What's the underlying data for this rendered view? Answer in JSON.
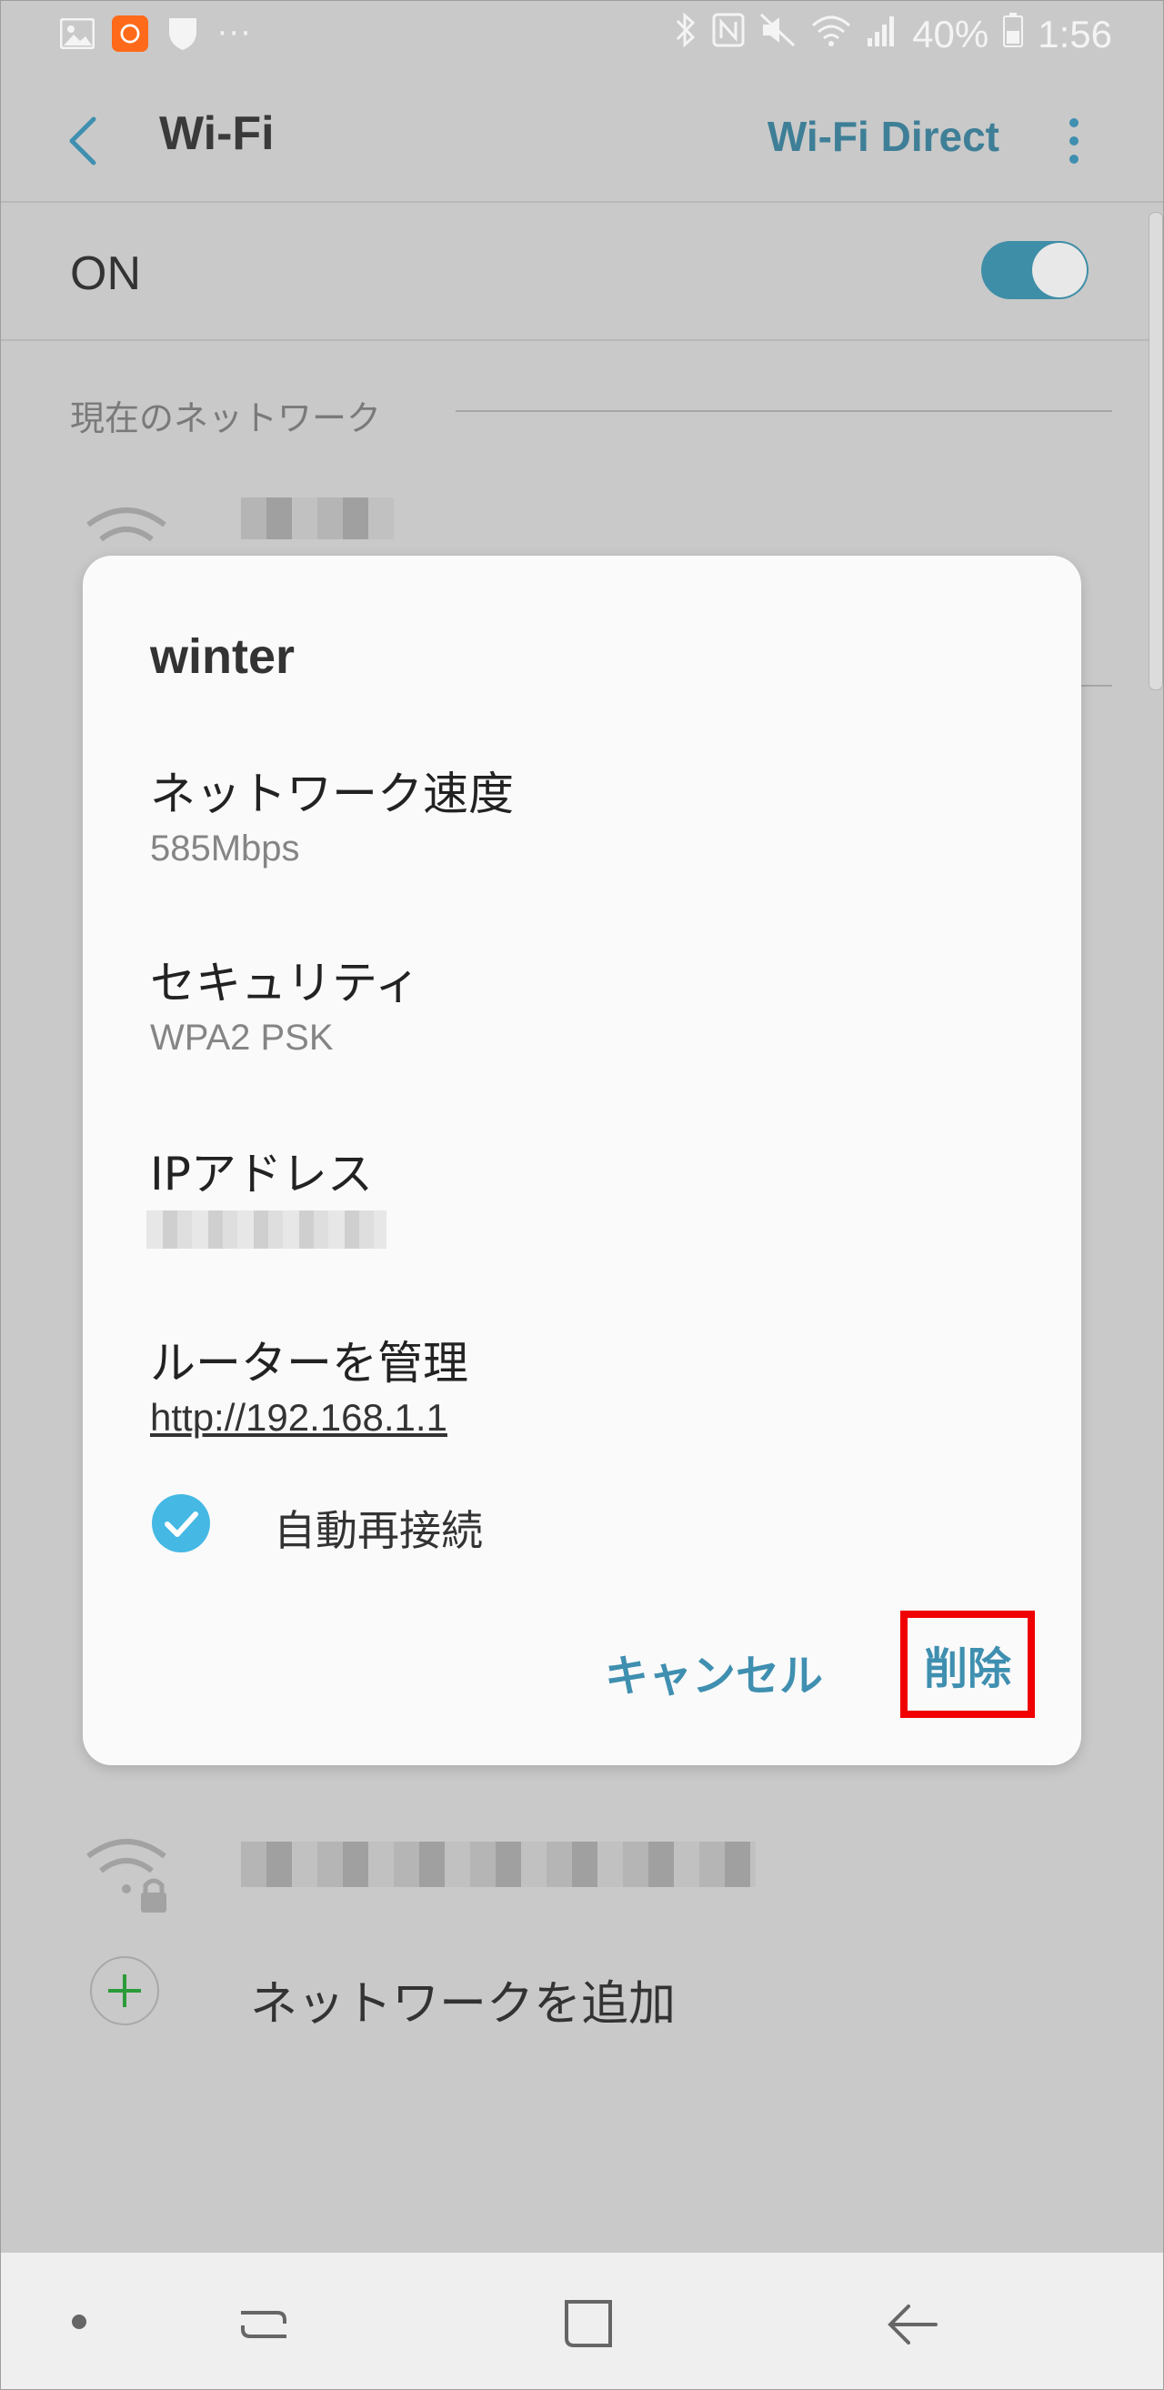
{
  "status_bar": {
    "battery": "40%",
    "time": "1:56",
    "overflow": "···",
    "icons": [
      "gallery-icon",
      "app-icon",
      "shield-icon",
      "bluetooth-icon",
      "nfc-icon",
      "mute-icon",
      "wifi-icon",
      "signal-icon",
      "battery-icon"
    ]
  },
  "app_bar": {
    "title": "Wi-Fi",
    "wifi_direct": "Wi-Fi Direct"
  },
  "toggle_row": {
    "label": "ON",
    "state": "on"
  },
  "sections": {
    "current_network": "現在のネットワーク"
  },
  "dialog": {
    "title": "winter",
    "speed_label": "ネットワーク速度",
    "speed_value": "585Mbps",
    "security_label": "セキュリティ",
    "security_value": "WPA2 PSK",
    "ip_label": "IPアドレス",
    "router_label": "ルーターを管理",
    "router_link": "http://192.168.1.1",
    "auto_reconnect_label": "自動再接続",
    "cancel_button": "キャンセル",
    "delete_button": "削除"
  },
  "add_network": {
    "label": "ネットワークを追加"
  },
  "colors": {
    "accent": "#3f8fb0",
    "highlight_box": "#f00000",
    "checkbox": "#45b8e4"
  }
}
